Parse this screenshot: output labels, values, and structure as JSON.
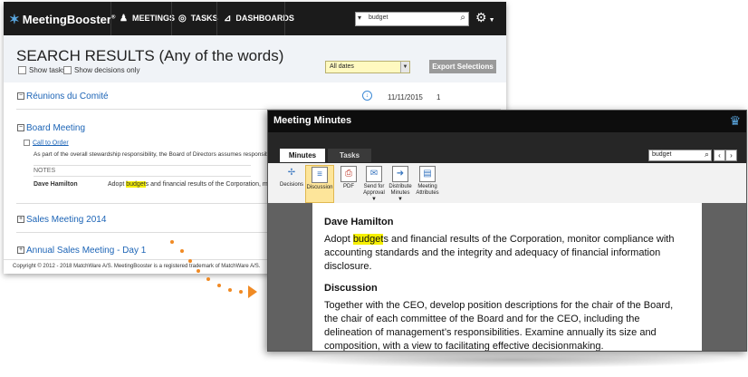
{
  "app": {
    "logo_text": "MeetingBooster",
    "logo_reg": "®",
    "nav": [
      {
        "label": "MEETINGS",
        "icon": "people-icon"
      },
      {
        "label": "TASKS",
        "icon": "check-circle-icon"
      },
      {
        "label": "DASHBOARDS",
        "icon": "chart-icon"
      }
    ],
    "search_value": "budget"
  },
  "search_results": {
    "title": "SEARCH RESULTS (Any of the words)",
    "show_tasks": "Show tasks",
    "show_decisions": "Show decisions only",
    "date_filter": "All dates",
    "export_button": "Export Selections",
    "groups": [
      {
        "title": "Réunions du Comité",
        "date": "11/11/2015",
        "count": "1"
      },
      {
        "title": "Board Meeting"
      },
      {
        "title": "Sales Meeting 2014"
      },
      {
        "title": "Annual Sales Meeting - Day 1"
      }
    ],
    "item_link": "Call to Order",
    "item_text": "As part of the overall stewardship responsibility, the Board of Directors assumes responsib",
    "notes_label": "NOTES",
    "note_author": "Dave Hamilton",
    "note_pre": "Adopt ",
    "note_hl": "budget",
    "note_post": "s and financial results of the Corporation, monito",
    "footer": "Copyright © 2012 - 2018 MatchWare A/S. MeetingBooster is a registered trademark of MatchWare A/S."
  },
  "minutes_window": {
    "title": "Meeting Minutes",
    "tabs": [
      "Minutes",
      "Tasks"
    ],
    "search_value": "budget",
    "toolbar": [
      {
        "label": "Decisions",
        "icon": "decisions-icon"
      },
      {
        "label": "Discussion",
        "icon": "discussion-icon"
      },
      {
        "label": "PDF",
        "icon": "pdf-icon"
      },
      {
        "label": "Send for Approval",
        "icon": "send-icon"
      },
      {
        "label": "Distribute Minutes",
        "icon": "distribute-icon"
      },
      {
        "label": "Meeting Attributes",
        "icon": "attributes-icon"
      }
    ],
    "doc": {
      "author": "Dave Hamilton",
      "line1_pre": "Adopt ",
      "line1_hl": "budget",
      "line1_post": "s and financial results of the Corporation, monitor compliance with",
      "line2": "accounting standards and the integrity and adequacy of financial information",
      "line3": "disclosure.",
      "section": "Discussion",
      "d1": "Together with the CEO, develop position descriptions for the chair of the Board,",
      "d2": "the chair of each committee of the Board and for the CEO, including the",
      "d3": "delineation of management’s responsibilities. Examine annually its size and",
      "d4": "composition, with a view to facilitating effective decisionmaking."
    }
  },
  "colors": {
    "highlight": "#f6f000",
    "link": "#1c64b6",
    "accent": "#f08a24"
  }
}
